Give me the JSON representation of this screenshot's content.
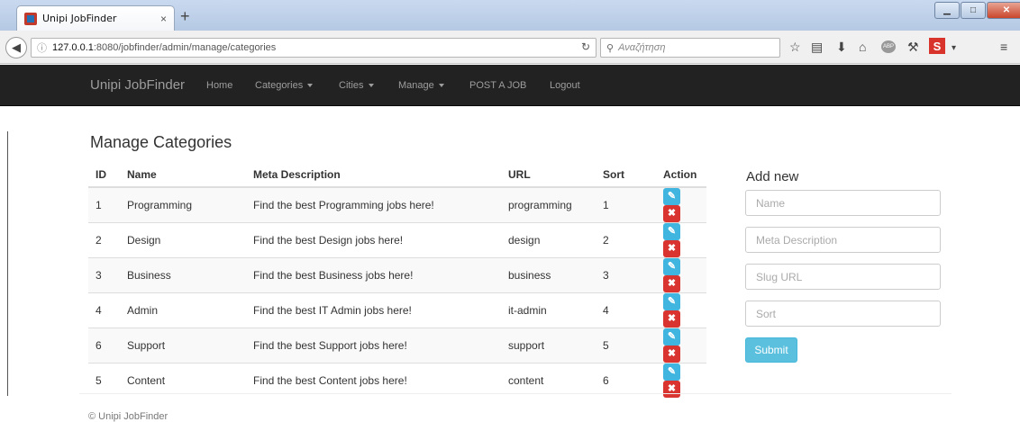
{
  "browser": {
    "tab_title": "Unipi JobFinder",
    "tab_close": "×",
    "new_tab": "+",
    "url_host": "127.0.0.1",
    "url_rest": ":8080/jobfinder/admin/manage/categories",
    "search_placeholder": "Αναζήτηση",
    "icons": [
      "back-icon",
      "info-icon",
      "reload-icon",
      "search-icon",
      "bookmark-star-icon",
      "reading-list-icon",
      "download-icon",
      "home-icon",
      "adblock-icon",
      "tools-icon",
      "s-extension-icon",
      "menu-icon"
    ]
  },
  "site_nav": {
    "brand": "Unipi JobFinder",
    "items": [
      {
        "label": "Home"
      },
      {
        "label": "Categories"
      },
      {
        "label": "Cities"
      },
      {
        "label": "Manage"
      },
      {
        "label": "POST A JOB"
      },
      {
        "label": "Logout"
      }
    ]
  },
  "main": {
    "title": "Manage Categories",
    "table": {
      "headers": [
        "ID",
        "Name",
        "Meta Description",
        "URL",
        "Sort",
        "Action"
      ],
      "rows": [
        {
          "id": "1",
          "name": "Programming",
          "meta": "Find the best Programming jobs here!",
          "url": "programming",
          "sort": "1"
        },
        {
          "id": "2",
          "name": "Design",
          "meta": "Find the best Design jobs here!",
          "url": "design",
          "sort": "2"
        },
        {
          "id": "3",
          "name": "Business",
          "meta": "Find the best Business jobs here!",
          "url": "business",
          "sort": "3"
        },
        {
          "id": "4",
          "name": "Admin",
          "meta": "Find the best IT Admin jobs here!",
          "url": "it-admin",
          "sort": "4"
        },
        {
          "id": "6",
          "name": "Support",
          "meta": "Find the best Support jobs here!",
          "url": "support",
          "sort": "5"
        },
        {
          "id": "5",
          "name": "Content",
          "meta": "Find the best Content jobs here!",
          "url": "content",
          "sort": "6"
        }
      ]
    }
  },
  "add_form": {
    "title": "Add new",
    "name_placeholder": "Name",
    "meta_placeholder": "Meta Description",
    "slug_placeholder": "Slug URL",
    "sort_placeholder": "Sort",
    "submit_label": "Submit"
  },
  "footer": {
    "text": "© Unipi JobFinder"
  },
  "colors": {
    "navbar_bg": "#222222",
    "nav_text": "#9d9d9d",
    "edit_button": "#3fb5df",
    "delete_button": "#d9342f",
    "submit_button": "#5bc0de"
  }
}
